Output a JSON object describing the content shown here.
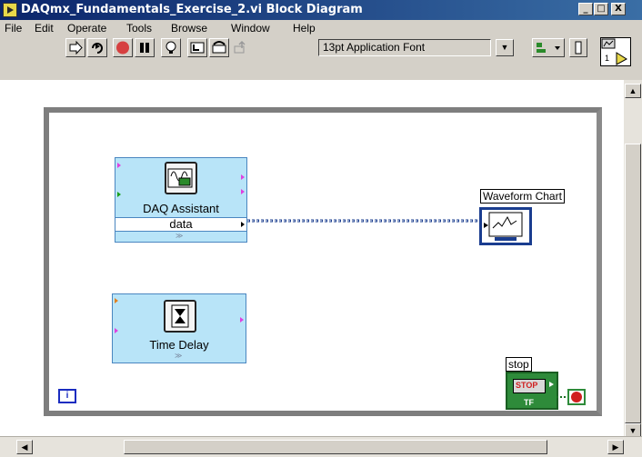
{
  "window": {
    "title": "DAQmx_Fundamentals_Exercise_2.vi Block Diagram",
    "controls": [
      "_",
      "□",
      "X"
    ]
  },
  "menu": [
    "File",
    "Edit",
    "Operate",
    "Tools",
    "Browse",
    "Window",
    "Help"
  ],
  "toolbar": {
    "buttons": [
      "run-arrow-icon",
      "run-continuous-icon",
      "abort-icon",
      "pause-icon",
      "highlight-execution-icon",
      "step-into-icon",
      "step-over-icon",
      "step-out-icon"
    ],
    "font_selector": "13pt Application Font",
    "align_button": "align-icon"
  },
  "diagram": {
    "daq_assistant": {
      "label": "DAQ Assistant",
      "output_label": "data"
    },
    "time_delay": {
      "label": "Time Delay"
    },
    "waveform_chart": {
      "label": "Waveform Chart"
    },
    "stop": {
      "label": "stop",
      "button_text": "STOP",
      "tf_text": "TF"
    },
    "iteration_terminal": "i"
  },
  "colors": {
    "titlebar": "#0a246a",
    "express_vi": "#b8e4f8",
    "wire": "#1a3d8f",
    "loop_border": "#7e7e7e",
    "boolean_terminal": "#2e8b3a"
  }
}
